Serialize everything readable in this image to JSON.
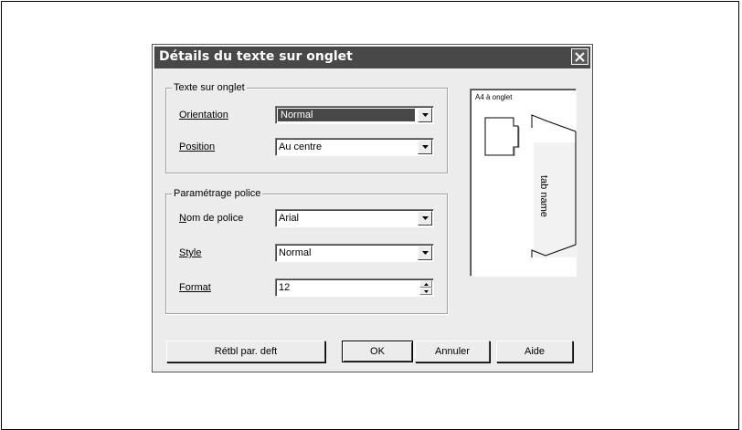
{
  "dialog": {
    "title": "Détails du texte sur onglet"
  },
  "tab_text_group": {
    "legend": "Texte sur onglet",
    "orientation": {
      "label": "Orientation",
      "value": "Normal"
    },
    "position": {
      "label": "Position",
      "value": "Au centre"
    }
  },
  "font_group": {
    "legend": "Paramétrage police",
    "font_name": {
      "label": "Nom de police",
      "value": "Arial"
    },
    "style": {
      "label": "Style",
      "value": "Normal"
    },
    "format": {
      "label": "Format",
      "value": "12"
    }
  },
  "preview": {
    "paper_label": "A4 à onglet",
    "tab_text": "tab name"
  },
  "buttons": {
    "reset": "Rétbl par. deft",
    "ok": "OK",
    "cancel": "Annuler",
    "help": "Aide"
  },
  "icons": {
    "close": "close-icon",
    "dropdown": "chevron-down-icon",
    "spin": "spin-arrows-icon"
  },
  "colors": {
    "titlebar": "#484848",
    "dialog_bg": "#ececec",
    "selection": "#484848"
  }
}
